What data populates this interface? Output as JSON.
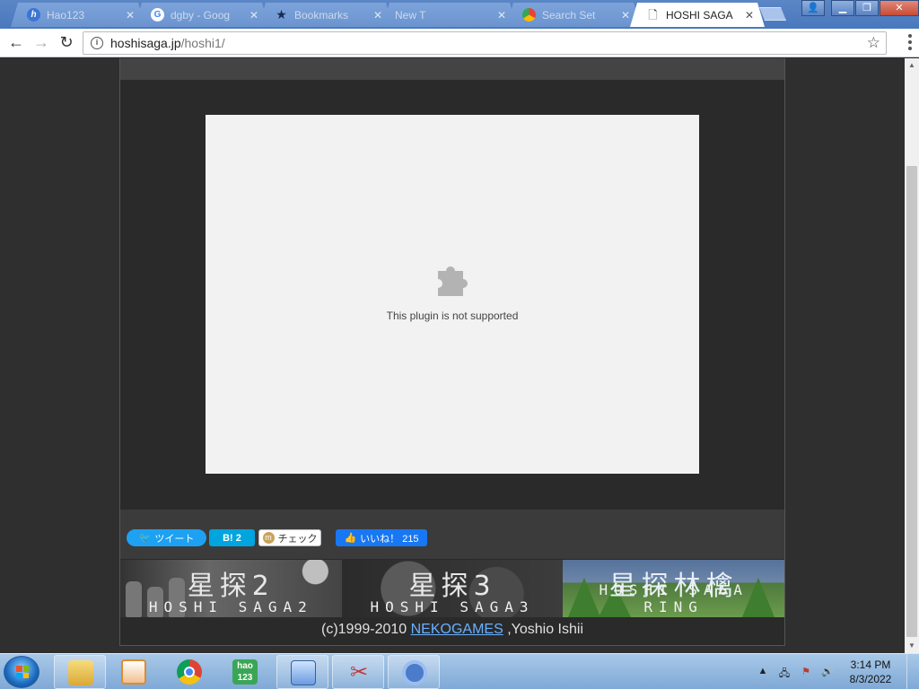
{
  "tabs": [
    {
      "label": "Hao123",
      "favicon": "hao123-icon",
      "active": false
    },
    {
      "label": "dgby - Goog",
      "favicon": "google-icon",
      "active": false
    },
    {
      "label": "Bookmarks",
      "favicon": "star-icon",
      "active": false
    },
    {
      "label": "New T",
      "favicon": "",
      "active": false
    },
    {
      "label": "Search Set",
      "favicon": "search-settings-icon",
      "active": false
    },
    {
      "label": "HOSHI SAGA",
      "favicon": "page-icon",
      "active": true
    }
  ],
  "address": {
    "host": "hoshisaga.jp",
    "path": "/hoshi1/"
  },
  "page": {
    "plugin_message": "This plugin is not supported",
    "social": {
      "tweet": "ツイート",
      "hatena": "B! 2",
      "mixi": "チェック",
      "like": "いいね！ 215"
    },
    "banners": [
      {
        "kanji": "星探2",
        "sub": "HOSHI SAGA2"
      },
      {
        "kanji": "星探3",
        "sub": "HOSHI SAGA3"
      },
      {
        "kanji": "星探林檎",
        "sub": "HOSHI SAGA RING"
      }
    ],
    "copyright_prefix": "(c)1999-2010 ",
    "copyright_link": "NEKOGAMES",
    "copyright_suffix": " ,Yoshio Ishii"
  },
  "taskbar": {
    "clock_time": "3:14 PM",
    "clock_date": "8/3/2022",
    "apps": [
      "file-explorer-icon",
      "media-player-icon",
      "chrome-icon",
      "hao123-icon",
      "control-panel-icon",
      "snipping-tool-icon",
      "chromium-icon"
    ]
  },
  "colors": {
    "tab_bar": "#4a78bd",
    "link": "#69b0ff",
    "like_blue": "#1877f2",
    "tweet_blue": "#1da1f2"
  }
}
